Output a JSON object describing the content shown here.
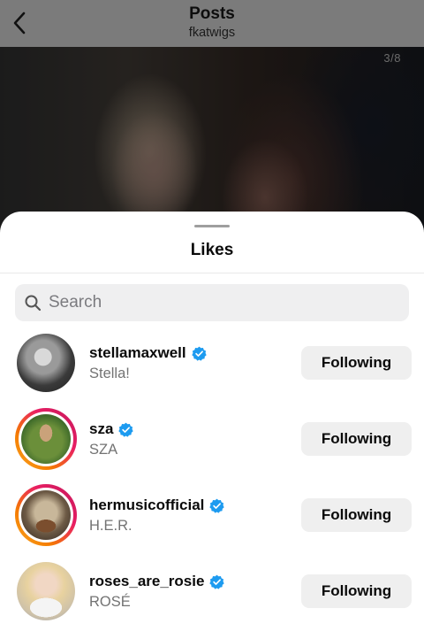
{
  "header": {
    "title": "Posts",
    "subtitle": "fkatwigs",
    "back_icon": "chevron-left-icon"
  },
  "post": {
    "page_indicator": "3/8"
  },
  "sheet": {
    "title": "Likes",
    "search": {
      "placeholder": "Search",
      "value": "",
      "icon": "search-icon"
    }
  },
  "likes": [
    {
      "username": "stellamaxwell",
      "full_name": "Stella!",
      "verified": true,
      "has_story": false,
      "button": "Following"
    },
    {
      "username": "sza",
      "full_name": "SZA",
      "verified": true,
      "has_story": true,
      "button": "Following"
    },
    {
      "username": "hermusicofficial",
      "full_name": "H.E.R.",
      "verified": true,
      "has_story": true,
      "button": "Following"
    },
    {
      "username": "roses_are_rosie",
      "full_name": "ROSÉ",
      "verified": true,
      "has_story": false,
      "button": "Following"
    }
  ],
  "colors": {
    "verified_badge": "#1d9bf0",
    "story_ring_start": "#f9a825",
    "story_ring_end": "#c2185b",
    "button_bg": "#efefef",
    "secondary_text": "#737373"
  }
}
